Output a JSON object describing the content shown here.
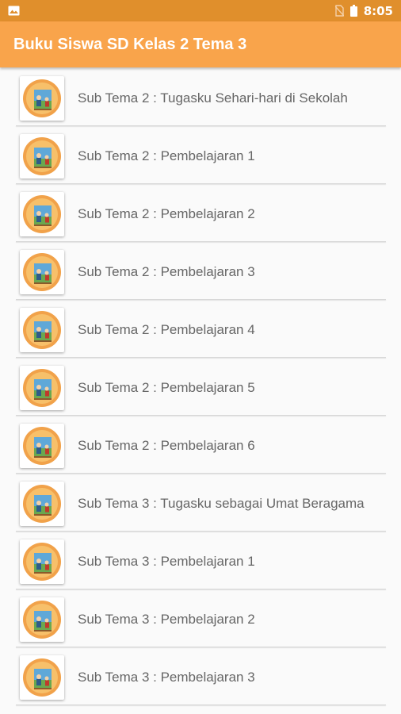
{
  "status_bar": {
    "time": "8:05",
    "icons": [
      "gallery-icon",
      "no-sim-icon",
      "battery-icon"
    ]
  },
  "app_bar": {
    "title": "Buku Siswa SD Kelas 2 Tema 3"
  },
  "colors": {
    "status_bar": "#e08f2c",
    "app_bar": "#f9a44b",
    "background": "#fafafa",
    "item_text": "#666666"
  },
  "list": {
    "items": [
      {
        "label": "Sub Tema 2 : Tugasku Sehari-hari di Sekolah",
        "icon": "book-cover-icon"
      },
      {
        "label": "Sub Tema 2 : Pembelajaran 1",
        "icon": "book-cover-icon"
      },
      {
        "label": "Sub Tema 2 : Pembelajaran 2",
        "icon": "book-cover-icon"
      },
      {
        "label": "Sub Tema 2 : Pembelajaran 3",
        "icon": "book-cover-icon"
      },
      {
        "label": "Sub Tema 2 : Pembelajaran 4",
        "icon": "book-cover-icon"
      },
      {
        "label": "Sub Tema 2 : Pembelajaran 5",
        "icon": "book-cover-icon"
      },
      {
        "label": "Sub Tema 2 : Pembelajaran 6",
        "icon": "book-cover-icon"
      },
      {
        "label": "Sub Tema 3 : Tugasku sebagai Umat Beragama",
        "icon": "book-cover-icon"
      },
      {
        "label": "Sub Tema 3 : Pembelajaran 1",
        "icon": "book-cover-icon"
      },
      {
        "label": "Sub Tema 3 : Pembelajaran 2",
        "icon": "book-cover-icon"
      },
      {
        "label": "Sub Tema 3 : Pembelajaran 3",
        "icon": "book-cover-icon"
      }
    ]
  }
}
